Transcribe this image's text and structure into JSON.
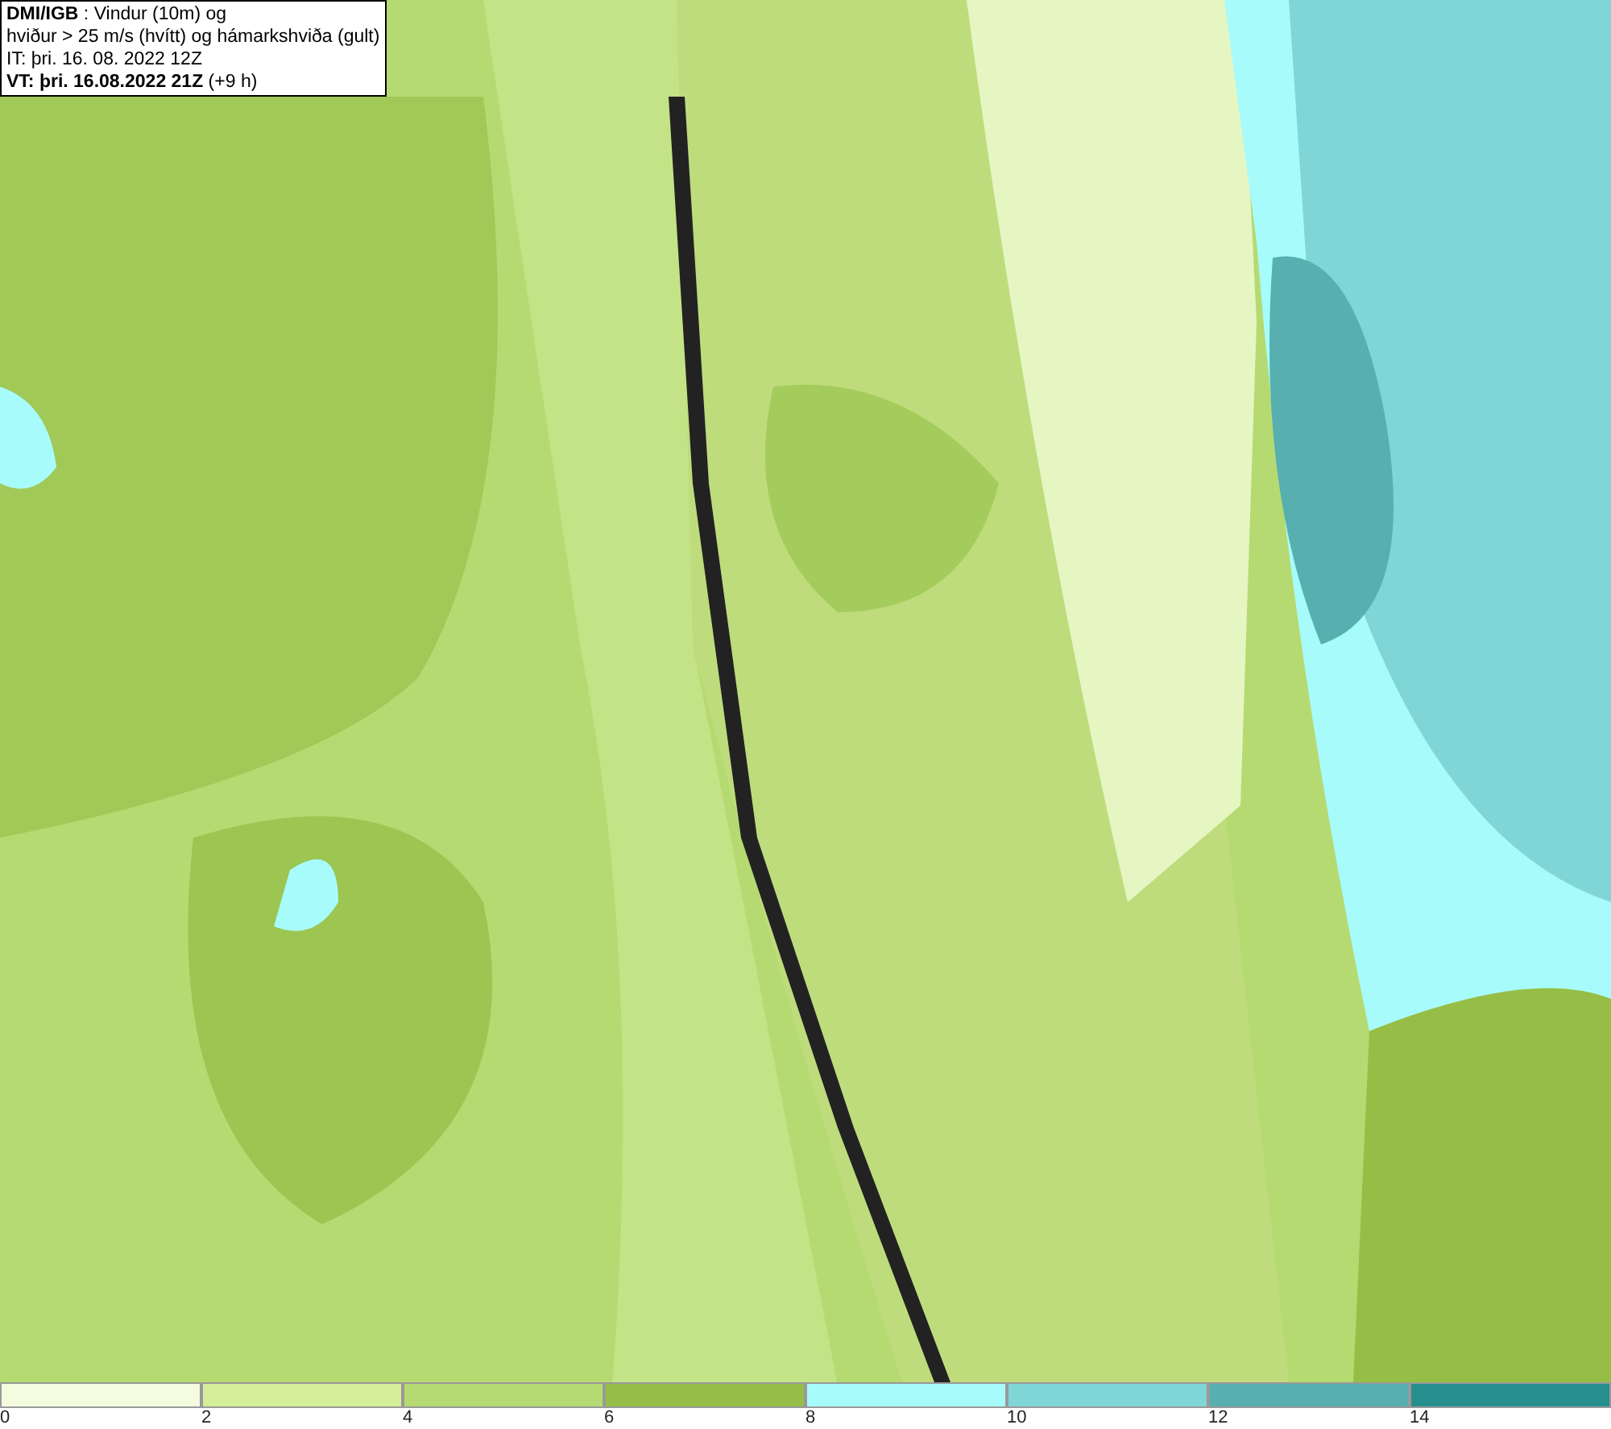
{
  "title_box": {
    "lines": [
      "**DMI/IGB** : Vindur (10m) og",
      "hviður > 25 m/s (hvítt) og hámarkshviða (gult)",
      "IT: þri. 16. 08. 2022 12Z",
      "**VT: þri. 16.08.2022 21Z** (+9 h)"
    ]
  },
  "legend": [
    {
      "label": "0",
      "color": "#f4fbdf"
    },
    {
      "label": "2",
      "color": "#d4ee9a"
    },
    {
      "label": "4",
      "color": "#b6da72"
    },
    {
      "label": "6",
      "color": "#96be46"
    },
    {
      "label": "8",
      "color": "#a8fbfb"
    },
    {
      "label": "10",
      "color": "#80d6d6"
    },
    {
      "label": "12",
      "color": "#57afb0"
    },
    {
      "label": "14",
      "color": "#268f8e"
    }
  ]
}
